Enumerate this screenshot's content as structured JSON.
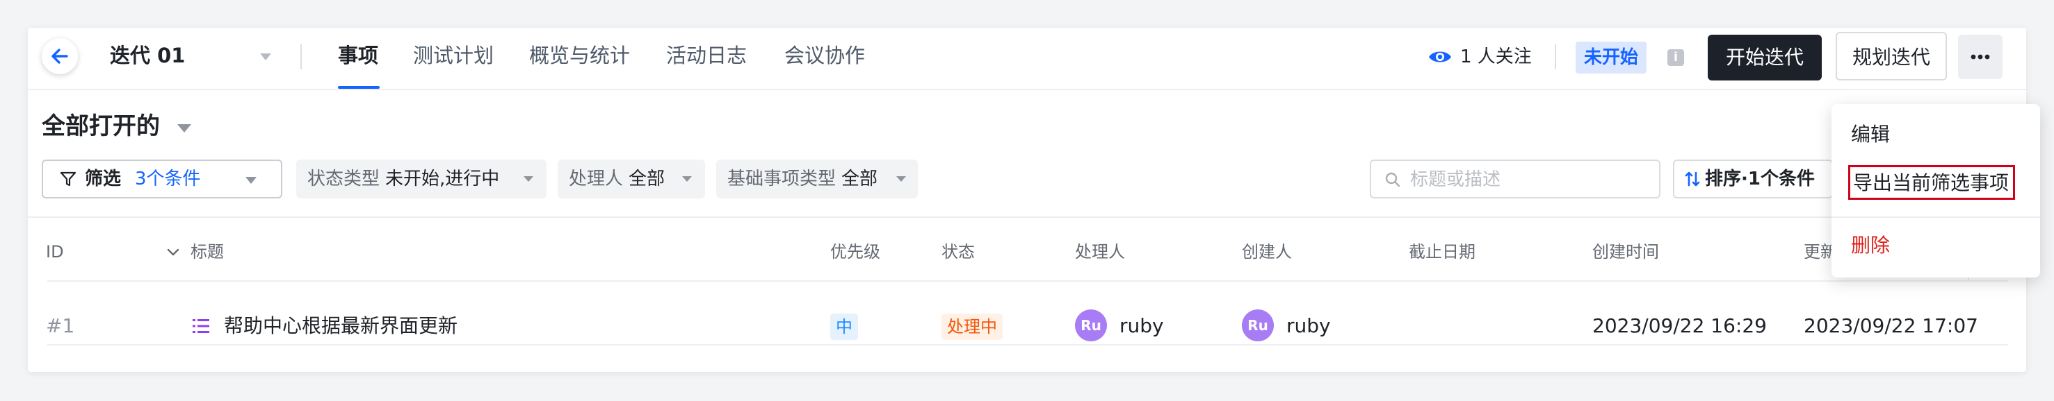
{
  "header": {
    "iteration_name": "迭代 01",
    "tabs": [
      {
        "label": "事项"
      },
      {
        "label": "测试计划"
      },
      {
        "label": "概览与统计"
      },
      {
        "label": "活动日志"
      },
      {
        "label": "会议协作"
      }
    ],
    "watchers": "1 人关注",
    "status": "未开始",
    "start_button": "开始迭代",
    "plan_button": "规划迭代"
  },
  "view": {
    "title": "全部打开的"
  },
  "filters": {
    "filter_label": "筛选",
    "filter_count": "3个条件",
    "chips": [
      {
        "key": "状态类型",
        "value": "未开始,进行中"
      },
      {
        "key": "处理人",
        "value": "全部"
      },
      {
        "key": "基础事项类型",
        "value": "全部"
      }
    ],
    "search_placeholder": "标题或描述",
    "sort_label": "排序·1个条件"
  },
  "table": {
    "columns": [
      "ID",
      "标题",
      "优先级",
      "状态",
      "处理人",
      "创建人",
      "截止日期",
      "创建时间",
      "更新时间"
    ],
    "rows": [
      {
        "id": "#1",
        "title": "帮助中心根据最新界面更新",
        "priority": "中",
        "state": "处理中",
        "assignee_initials": "Ru",
        "assignee": "ruby",
        "creator_initials": "Ru",
        "creator": "ruby",
        "due": "",
        "created": "2023/09/22 16:29",
        "updated": "2023/09/22 17:07"
      }
    ]
  },
  "menu": {
    "items": [
      {
        "label": "编辑"
      },
      {
        "label": "导出当前筛选事项"
      },
      {
        "label": "删除"
      }
    ]
  },
  "colors": {
    "accent": "#1664ff",
    "dark_button": "#1d2129",
    "danger": "#e0201b",
    "highlight_box": "#d0021b",
    "avatar": "#a87cf5"
  }
}
